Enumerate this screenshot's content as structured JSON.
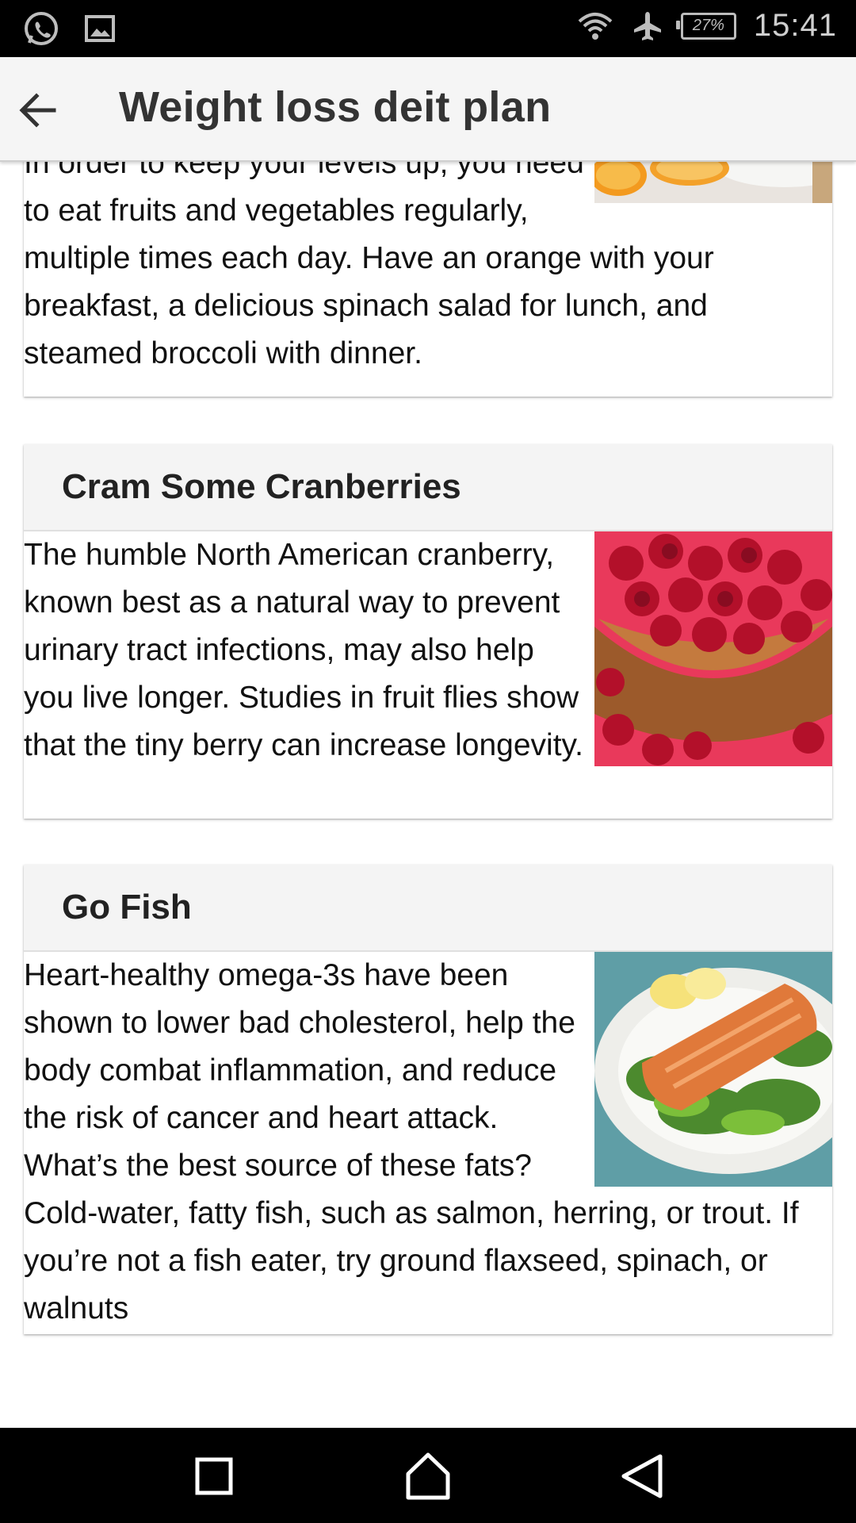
{
  "status_bar": {
    "time": "15:41",
    "battery": "27%",
    "left_icons": [
      "whatsapp-icon",
      "gallery-icon"
    ],
    "right_icons": [
      "wifi-icon",
      "airplane-icon",
      "battery-icon"
    ]
  },
  "app_bar": {
    "title": "Weight loss deit plan",
    "back_icon": "arrow-left-icon"
  },
  "cards": [
    {
      "title": "",
      "text": "In order to keep your levels up, you need to eat fruits and vegetables regularly, multiple times each day. Have an orange with your breakfast, a delicious spinach salad for lunch, and steamed broccoli with dinner.",
      "image": "oranges-image"
    },
    {
      "title": "Cram Some Cranberries",
      "text": "The humble North American cranberry, known best as a natural way to prevent urinary tract infections, may also help you live longer. Studies in fruit flies show that the tiny berry can increase longevity.",
      "image": "cranberries-image"
    },
    {
      "title": "Go Fish",
      "text": "Heart-healthy omega-3s have been shown to lower bad cholesterol, help the body combat inflammation, and reduce the risk of cancer and heart attack. What’s the best source of these fats? Cold-water, fatty fish, such as salmon, herring, or trout. If you’re not a fish eater, try ground flaxseed, spinach, or walnuts",
      "image": "salmon-salad-image"
    }
  ],
  "nav_bar": {
    "buttons": [
      "recents-square-icon",
      "home-icon",
      "back-triangle-icon"
    ]
  }
}
